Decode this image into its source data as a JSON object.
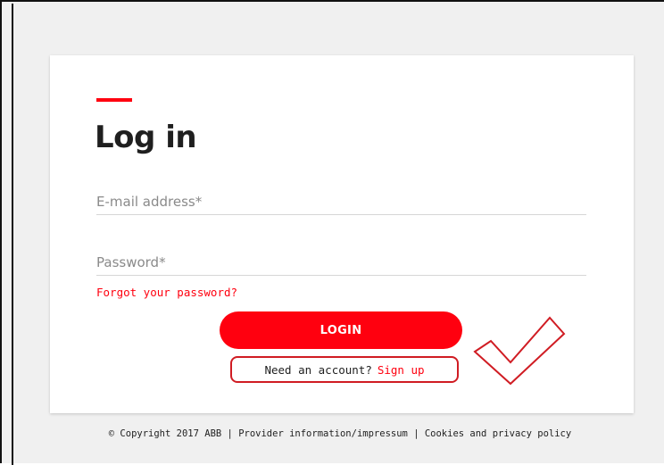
{
  "login": {
    "title": "Log in",
    "email_placeholder": "E-mail address*",
    "password_placeholder": "Password*",
    "forgot_password": "Forgot your password?",
    "login_button": "LOGIN",
    "signup_prompt": "Need an account?",
    "signup_link": "Sign up"
  },
  "footer": {
    "copyright": "© Copyright 2017 ABB",
    "separator": "|",
    "provider_info": "Provider information/impressum",
    "cookies_policy": "Cookies and privacy policy"
  },
  "colors": {
    "accent": "#ff000f",
    "annotation": "#d01c23",
    "background": "#f0f0f0",
    "card": "#ffffff"
  },
  "icons": {
    "annotation_mark": "checkmark-icon"
  }
}
